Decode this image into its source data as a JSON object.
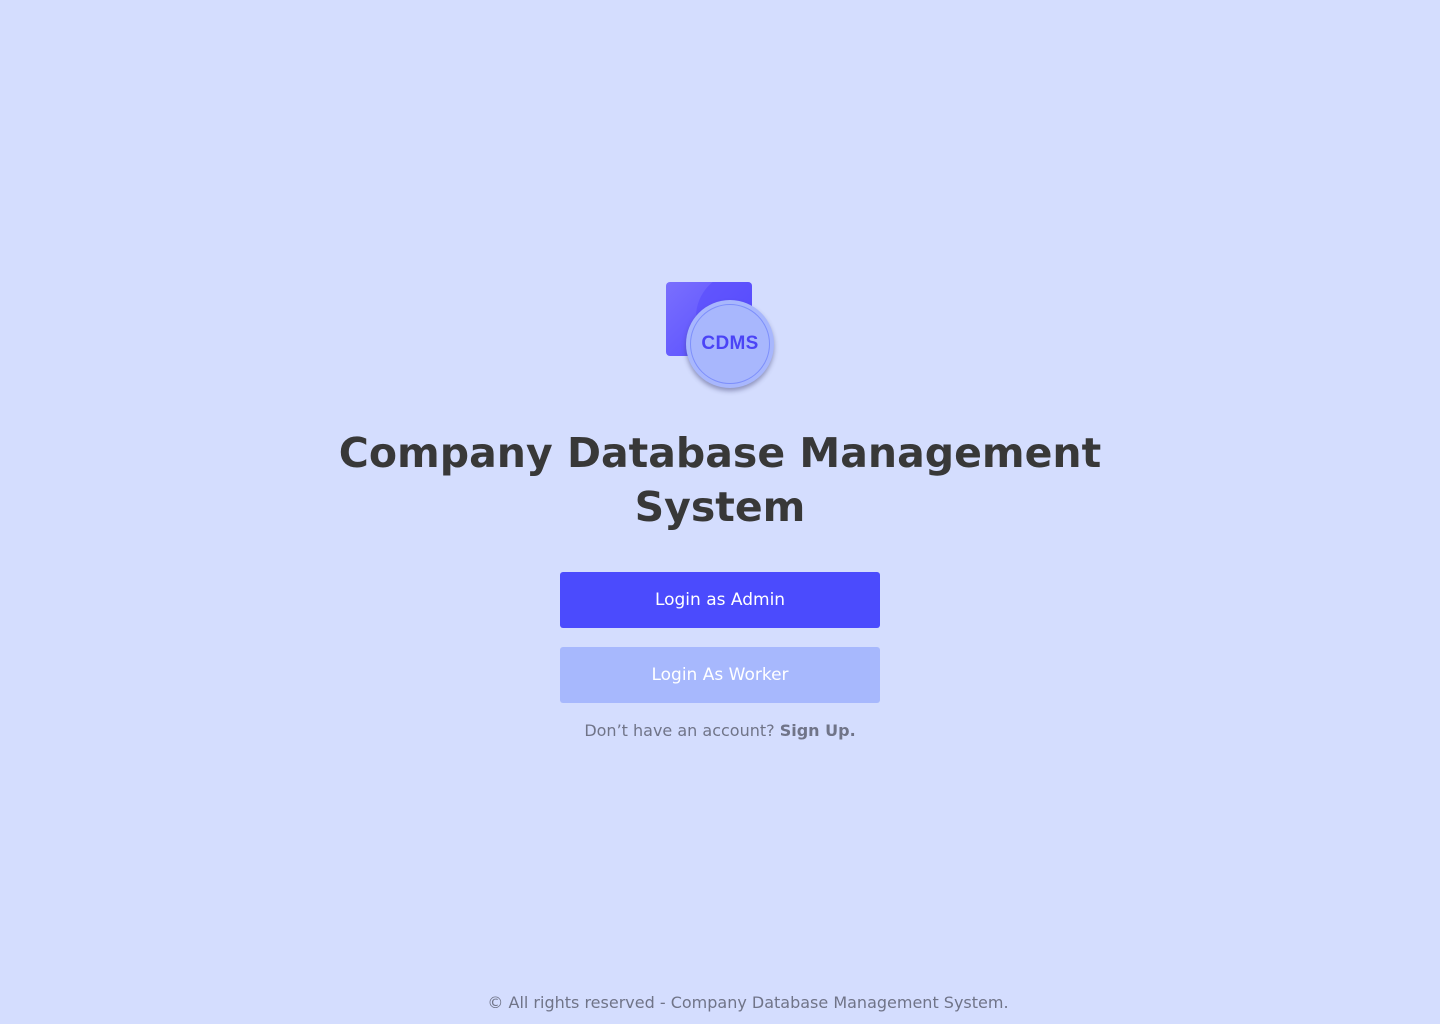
{
  "logo": {
    "text": "CDMS"
  },
  "title": "Company Database Management System",
  "buttons": {
    "admin_label": "Login as Admin",
    "worker_label": "Login As Worker"
  },
  "signup": {
    "prompt": "Don’t have an account?",
    "link_label": "Sign Up."
  },
  "footer": {
    "text": "© All rights reserved - Company Database Management System."
  },
  "colors": {
    "background": "#d4ddfe",
    "primary": "#4b4bfd",
    "secondary": "#a7b8fd",
    "title": "#383838",
    "muted_text": "#707488"
  }
}
